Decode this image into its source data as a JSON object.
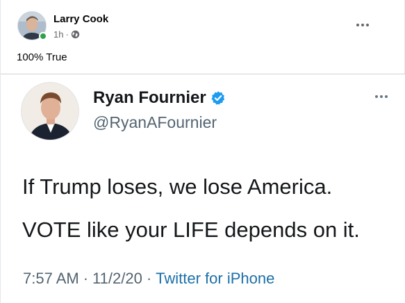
{
  "post": {
    "author": "Larry Cook",
    "time": "1h",
    "separator": "·",
    "privacy_icon": "globe-icon",
    "text": "100% True",
    "more_icon": "more-options-icon"
  },
  "tweet": {
    "name": "Ryan Fournier",
    "verified_icon": "verified-badge-icon",
    "handle": "@RyanAFournier",
    "lines": [
      "If Trump loses, we lose America.",
      "VOTE like your LIFE depends on it."
    ],
    "time": "7:57 AM",
    "date": "11/2/20",
    "separator": "·",
    "source": "Twitter for iPhone"
  },
  "colors": {
    "online": "#31a24c",
    "verified": "#1d9bf0",
    "link": "#1b6fa8"
  }
}
